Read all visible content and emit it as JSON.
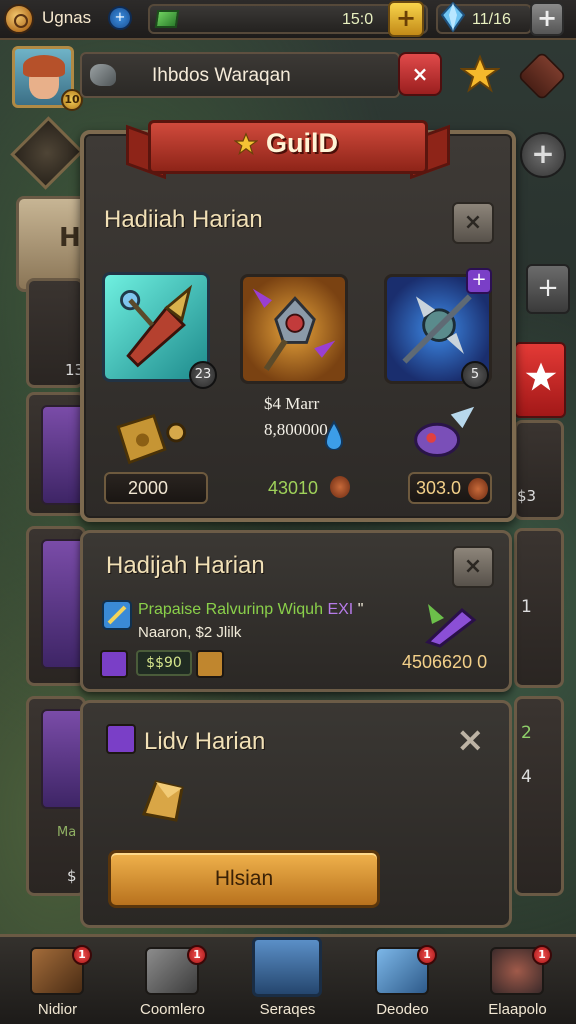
{
  "topbar": {
    "player_name": "Ugnas",
    "info_badge": "+",
    "green_resource_value": "15:0",
    "gold_plus": "+",
    "gem_value": "11/16",
    "gray_plus": "+"
  },
  "header": {
    "level_badge": "10",
    "title": "Ihbdos Waraqan",
    "close_label": "×"
  },
  "side": {
    "partial_letter": "H",
    "partial_13": "13",
    "partial_s3": "$3",
    "partial_1": "1",
    "partial_2": "2",
    "partial_4": "4",
    "partial_ma": "Ma",
    "partial_s": "$",
    "plus_label": "+"
  },
  "guild": {
    "ribbon_title": "GuilD",
    "section_title": "Hadiiah Harian",
    "close_label": "×",
    "tiles": [
      {
        "count": "23"
      },
      {
        "count": ""
      },
      {
        "count": "5",
        "plus": "+"
      }
    ],
    "mid_line_1": "$4 Marr",
    "mid_line_2": "8,800000",
    "prices": [
      "2000",
      "43010",
      "303.0"
    ],
    "colors": {
      "accent_red": "#c63a2c",
      "gold": "#e8a93a",
      "green_text": "#9fd15a"
    }
  },
  "panel2": {
    "title": "Hadijah Harian",
    "close_label": "×",
    "quest_text_main": "Prapaise Ralvurinp Wiquh",
    "quest_text_purple": "EXI",
    "quest_text_tail": "\"",
    "quest_sub": "Naaron, $2 Jlilk",
    "mini_value": "$$90",
    "reward_value": "4506620 0"
  },
  "panel3": {
    "title": "Lidv Harian",
    "close_label": "×",
    "button_label": "Hlsian"
  },
  "bottom_nav": [
    {
      "label": "Nidior",
      "badge": "1",
      "icon": "scroll-icon"
    },
    {
      "label": "Coomlero",
      "badge": "1",
      "icon": "rune-stone-icon"
    },
    {
      "label": "Seraqes",
      "badge": "",
      "icon": "castle-icon"
    },
    {
      "label": "Deodeo",
      "badge": "1",
      "icon": "crystal-icon"
    },
    {
      "label": "Elaapolo",
      "badge": "1",
      "icon": "gear-stone-icon"
    }
  ]
}
